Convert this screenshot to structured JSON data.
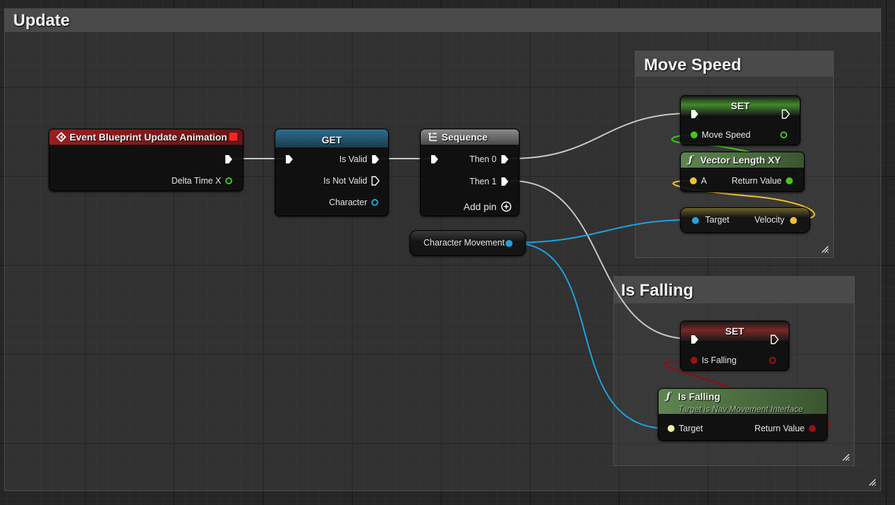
{
  "comments": {
    "update": "Update",
    "move_speed": "Move Speed",
    "is_falling": "Is Falling"
  },
  "event_node": {
    "title": "Event Blueprint Update Animation",
    "delta_time": "Delta Time X"
  },
  "get_node": {
    "title": "GET",
    "is_valid": "Is Valid",
    "is_not_valid": "Is Not Valid",
    "character": "Character"
  },
  "sequence_node": {
    "title": "Sequence",
    "then0": "Then 0",
    "then1": "Then 1",
    "add_pin": "Add pin"
  },
  "char_movement_node": {
    "label": "Character Movement"
  },
  "set_move_speed": {
    "title": "SET",
    "pin": "Move Speed"
  },
  "vector_length_node": {
    "title": "Vector Length XY",
    "a": "A",
    "return_value": "Return Value"
  },
  "velocity_node": {
    "target": "Target",
    "velocity": "Velocity"
  },
  "set_is_falling": {
    "title": "SET",
    "pin": "Is Falling"
  },
  "is_falling_func": {
    "title": "Is Falling",
    "subtitle": "Target is Nav Movement Interface",
    "target": "Target",
    "return_value": "Return Value"
  },
  "icons": {
    "event": "event-diamond-icon",
    "sequence": "sequence-icon",
    "function": "function-icon",
    "add": "add-pin-icon",
    "grip": "resize-grip-icon"
  },
  "colors": {
    "event_header": "#8c1a1a",
    "get_header": "#2b5d7a",
    "set_move_speed_header": "#3d6b2c",
    "set_is_falling_header": "#6b2323",
    "function_header": "#4f7042",
    "exec_wire": "#c8c8c8",
    "float_pin": "#44c71d",
    "vector_pin": "#f0c02c",
    "object_pin": "#1ea3e0",
    "bool_pin": "#8e0e0e",
    "interface_pin": "#f2f2a0"
  }
}
